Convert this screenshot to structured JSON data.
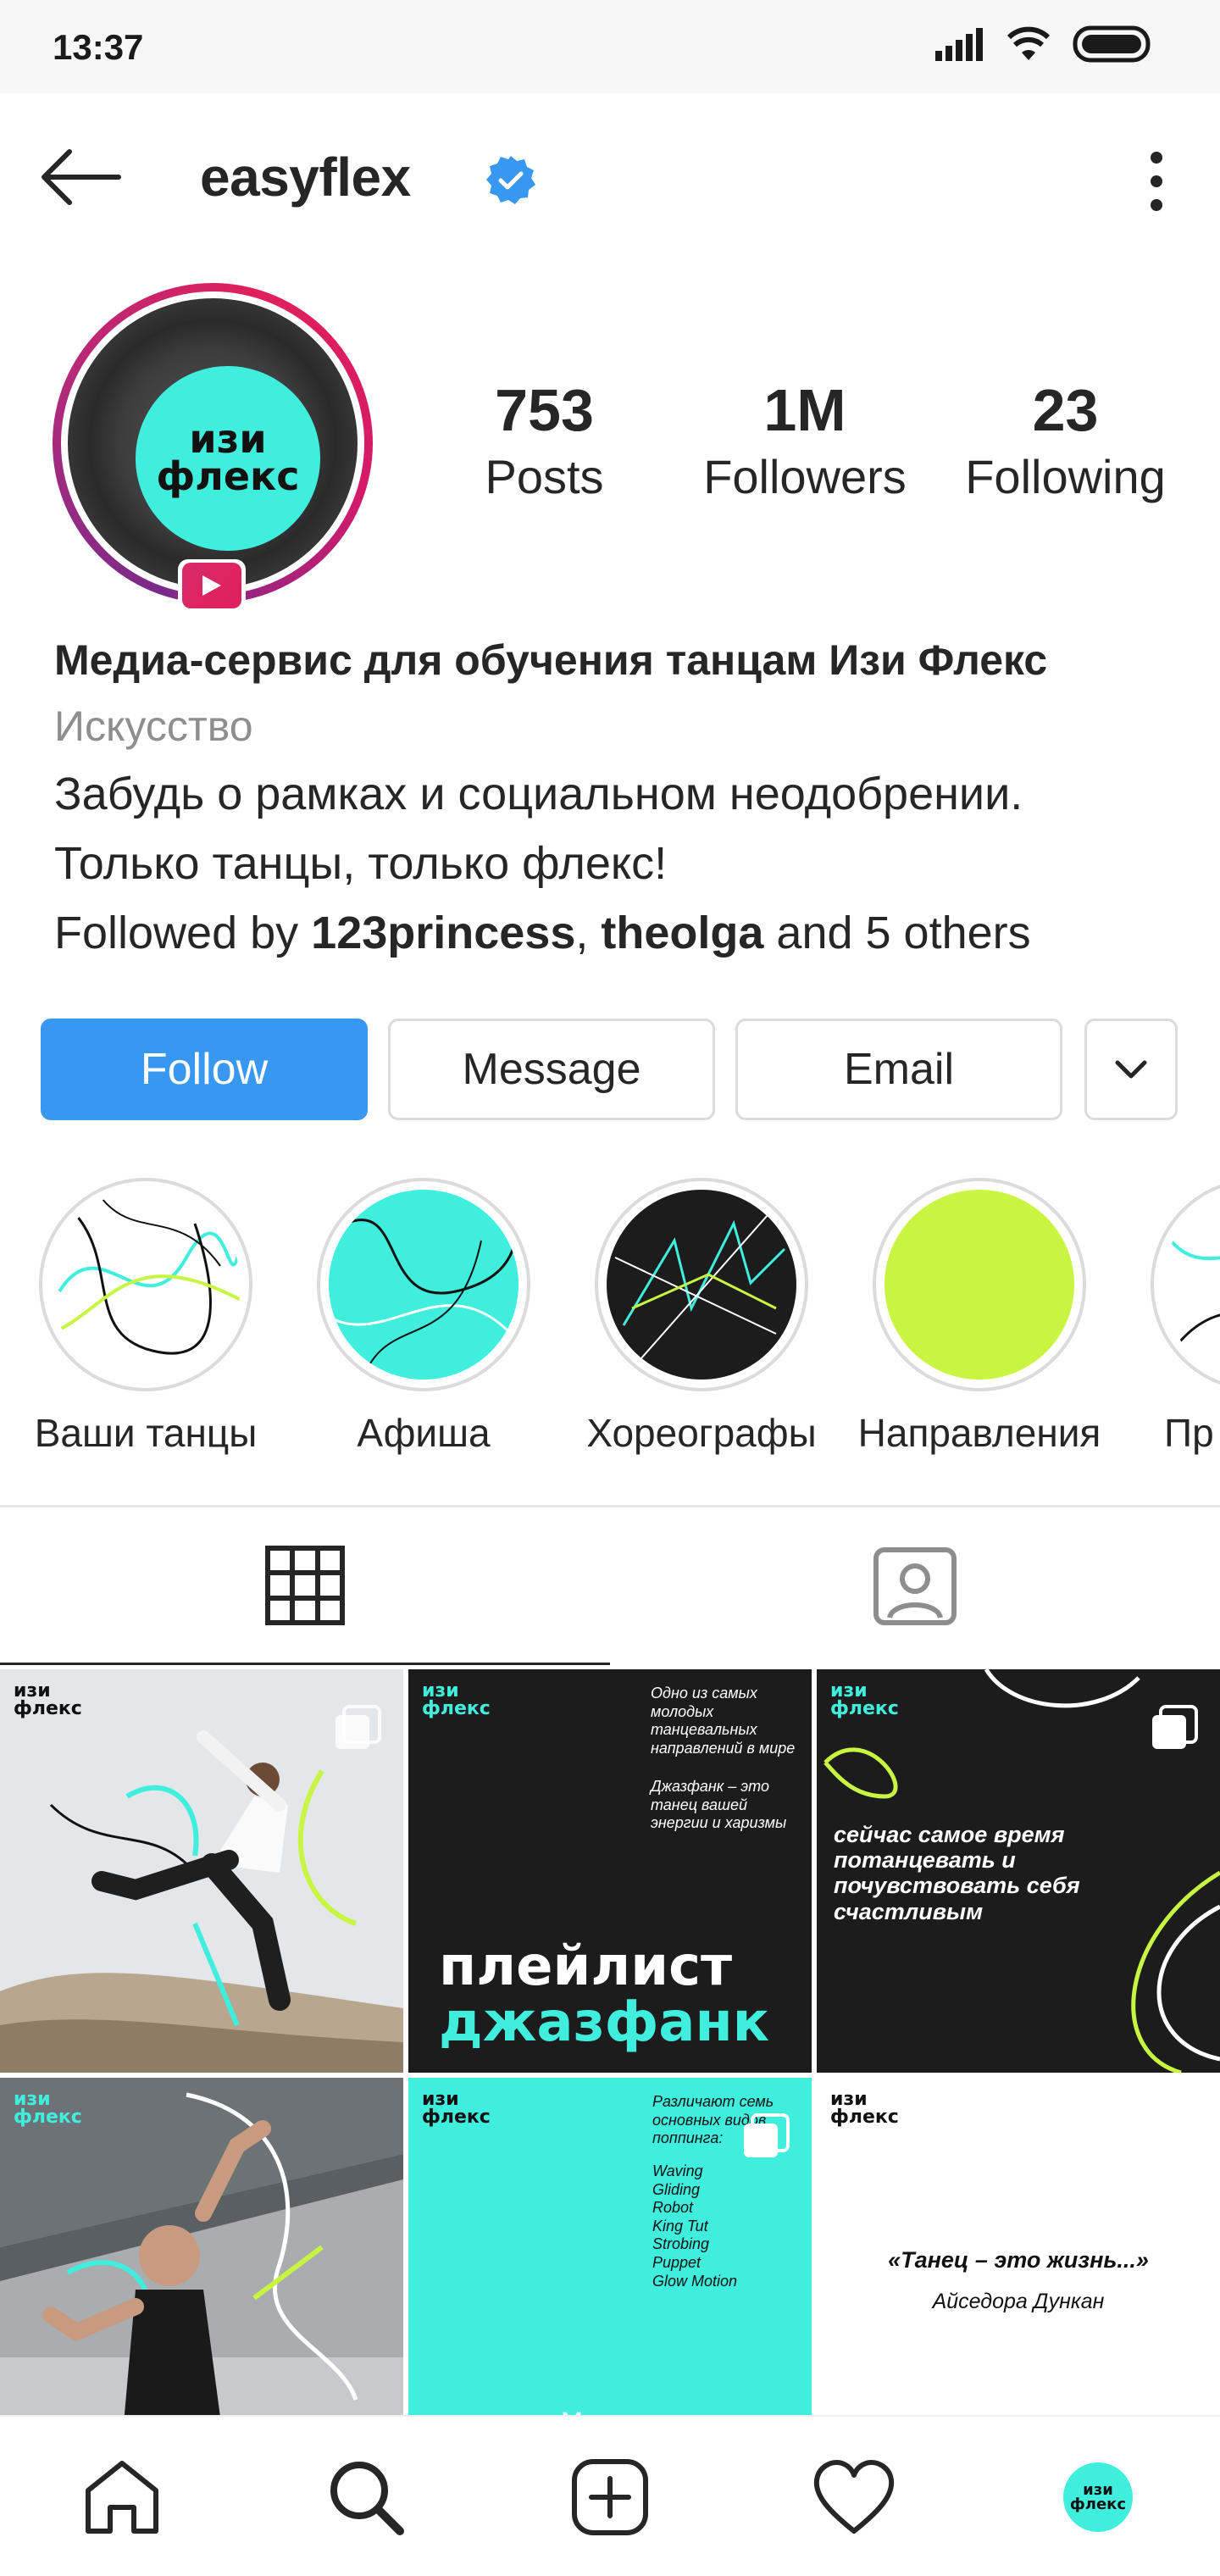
{
  "status_bar": {
    "time": "13:37"
  },
  "header": {
    "username": "easyflex"
  },
  "profile": {
    "avatar_logo_line1": "изи",
    "avatar_logo_line2": "флекс",
    "stats": [
      {
        "value": "753",
        "label": "Posts"
      },
      {
        "value": "1M",
        "label": "Followers"
      },
      {
        "value": "23",
        "label": "Following"
      }
    ],
    "bio": {
      "name": "Медиа-сервис для обучения танцам Изи Флекс",
      "category": "Искусство",
      "line1": "Забудь о рамках и социальном неодобрении.",
      "line2": "Только танцы, только флекс!",
      "followed_prefix": "Followed by ",
      "followed_user1": "123princess",
      "followed_sep": ", ",
      "followed_user2": "theolga",
      "followed_suffix": " and 5 others"
    }
  },
  "actions": {
    "follow": "Follow",
    "message": "Message",
    "email": "Email"
  },
  "highlights": [
    {
      "label": "Ваши танцы"
    },
    {
      "label": "Афиша"
    },
    {
      "label": "Хореографы"
    },
    {
      "label": "Направления"
    },
    {
      "label": "Пр"
    }
  ],
  "posts": {
    "logo_line1": "изи",
    "logo_line2": "флекс",
    "p2_small": "Одно из самых молодых танцевальных направлений в мире",
    "p2_small2": "Джазфанк – это танец вашей энергии и харизмы",
    "p2_big1": "плейлист",
    "p2_big2": "джазфанк",
    "p3_mid": "сейчас самое время потанцевать и почувствовать себя счастливым",
    "p5_small": "Различают семь основных видов поппинга:",
    "p5_list": "Waving\nGliding\nRobot\nKing Tut\nStrobing\nPuppet\nGlow Motion",
    "p5_big": "плейлист",
    "p6_quote": "«Танец – это жизнь...»",
    "p6_author": "Айседора Дункан"
  },
  "colors": {
    "accent": "#3897f0",
    "brand_mint": "#40eedd",
    "brand_lime": "#c8f542",
    "verified": "#3897f0"
  },
  "icons": [
    "back-arrow-icon",
    "verified-icon",
    "more-vertical-icon",
    "grid-icon",
    "tagged-icon",
    "home-icon",
    "search-icon",
    "add-post-icon",
    "heart-icon"
  ]
}
